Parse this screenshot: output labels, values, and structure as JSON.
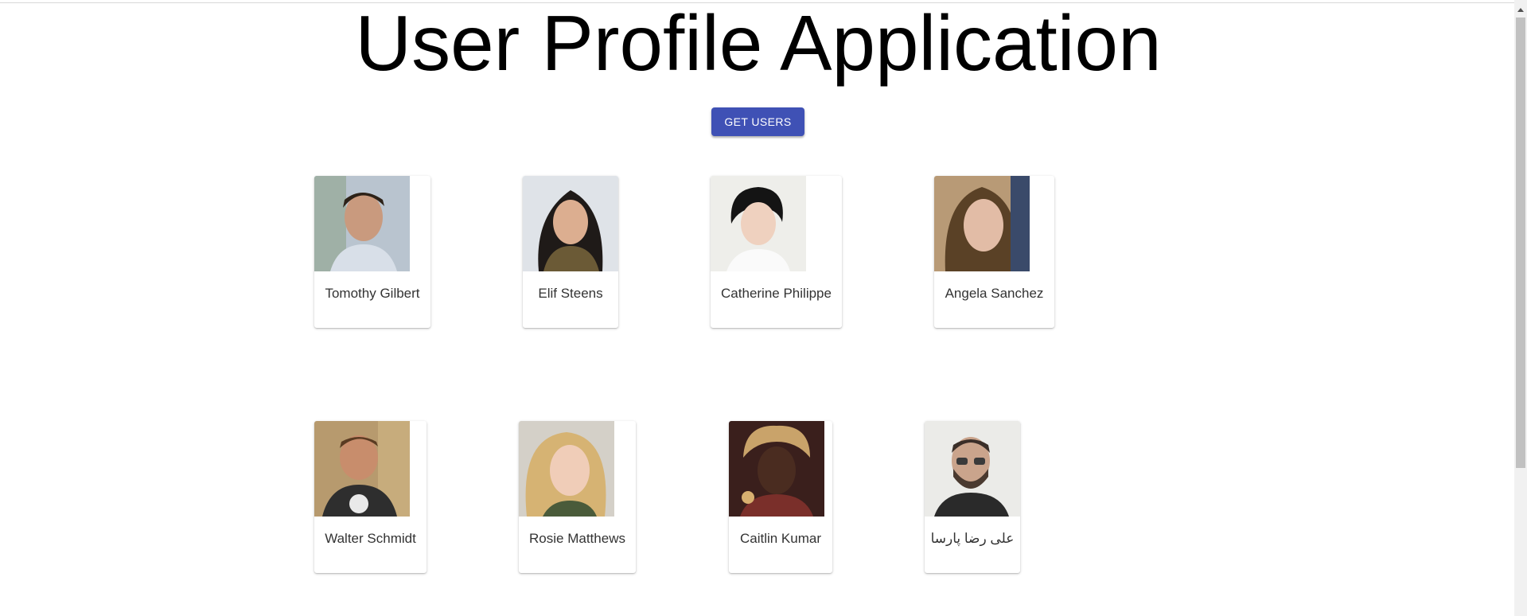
{
  "header": {
    "title": "User Profile Application"
  },
  "actions": {
    "get_users_label": "GET USERS"
  },
  "users": [
    {
      "name": "Tomothy Gilbert"
    },
    {
      "name": "Elif Steens"
    },
    {
      "name": "Catherine Philippe"
    },
    {
      "name": "Angela Sanchez"
    },
    {
      "name": "Walter Schmidt"
    },
    {
      "name": "Rosie Matthews"
    },
    {
      "name": "Caitlin Kumar"
    },
    {
      "name": "علی رضا پارسا"
    }
  ],
  "colors": {
    "primary_button": "#3f51b5",
    "scrollbar_thumb": "#c1c1c1"
  },
  "icons": {
    "scroll_up": "scroll-up-arrow-icon"
  }
}
